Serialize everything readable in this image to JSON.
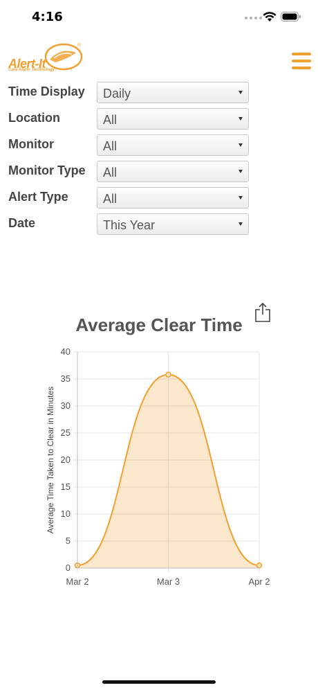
{
  "status_bar": {
    "time": "4:16"
  },
  "header": {
    "logo_text": "Alert-It",
    "logo_registered": "®",
    "logo_tagline": "Care Alarm Technology",
    "menu_icon": "hamburger-menu-icon",
    "accent_color": "#f0a030"
  },
  "filters": [
    {
      "label": "Time Display",
      "value": "Daily"
    },
    {
      "label": "Location",
      "value": "All"
    },
    {
      "label": "Monitor",
      "value": "All"
    },
    {
      "label": "Monitor Type",
      "value": "All"
    },
    {
      "label": "Alert Type",
      "value": "All"
    },
    {
      "label": "Date",
      "value": "This Year"
    }
  ],
  "chart_data": {
    "type": "area",
    "title": "Average Clear Time",
    "xlabel": "",
    "ylabel": "Average Time Taken to Clear in Minutes",
    "categories": [
      "Mar 2",
      "Mar 3",
      "Apr 2"
    ],
    "series": [
      {
        "values": [
          0.5,
          35.8,
          0.5
        ],
        "color": "#f0a030"
      }
    ],
    "ylim": [
      0,
      40
    ],
    "yticks": [
      0,
      5,
      10,
      15,
      20,
      25,
      30,
      35,
      40
    ],
    "grid": true,
    "legend": "none"
  },
  "share_icon": "share-icon"
}
